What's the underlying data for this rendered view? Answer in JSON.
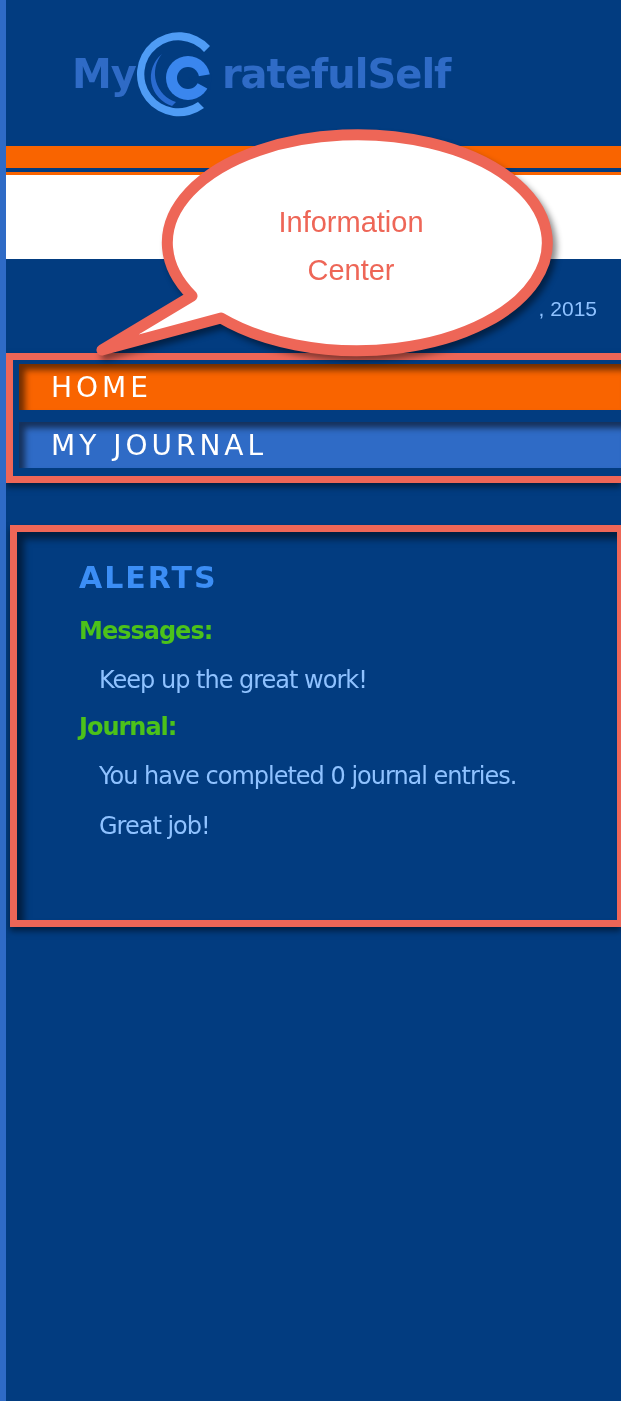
{
  "logo": {
    "text_before": "My",
    "text_after": "ratefulSelf"
  },
  "date": ", 2015",
  "callout": {
    "text": "Information Center"
  },
  "nav": [
    {
      "label": "HOME",
      "selected": true
    },
    {
      "label": "MY JOURNAL",
      "selected": false
    }
  ],
  "alerts": {
    "title": "ALERTS",
    "sections": [
      {
        "label": "Messages:",
        "text": "Keep up the great work!"
      },
      {
        "label": "Journal:",
        "text": "You have completed 0 journal entries. Great job!"
      }
    ]
  }
}
